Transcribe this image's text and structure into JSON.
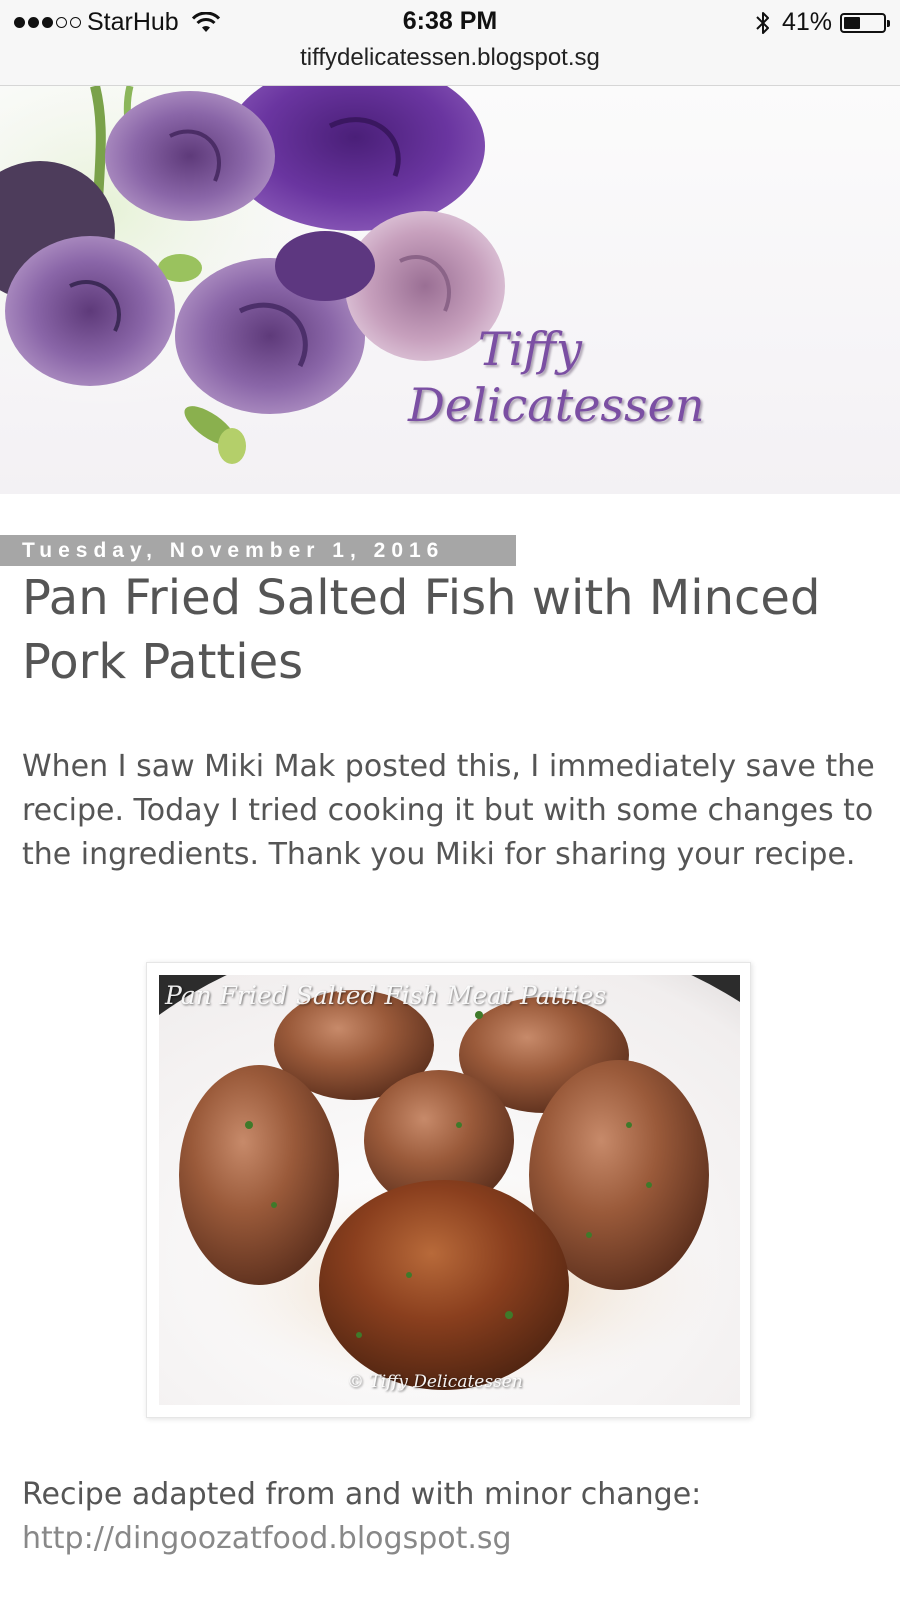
{
  "status_bar": {
    "carrier": "StarHub",
    "time": "6:38 PM",
    "battery": "41%",
    "battery_level": 0.41,
    "signal_bars": 3,
    "signal_total": 5
  },
  "browser": {
    "url": "tiffydelicatessen.blogspot.sg"
  },
  "header": {
    "title_line1": "Tiffy",
    "title_line2": "Delicatessen"
  },
  "post": {
    "date": "Tuesday, November 1, 2016",
    "title": "Pan Fried Salted Fish with Minced Pork Patties",
    "intro": "When I saw Miki Mak posted this, I immediately save the recipe. Today I tried cooking it but with some changes to the ingredients.  Thank you Miki for sharing your recipe.",
    "photo": {
      "caption": "Pan Fried Salted Fish Meat Patties",
      "watermark": "© Tiffy Delicatessen"
    },
    "source_label": "Recipe adapted from and with minor change: ",
    "source_link": "http://dingoozatfood.blogspot.sg"
  },
  "colors": {
    "accent_purple": "#7b4fa3",
    "date_bar": "#a6a6a6",
    "text": "#555555",
    "link": "#888888"
  }
}
